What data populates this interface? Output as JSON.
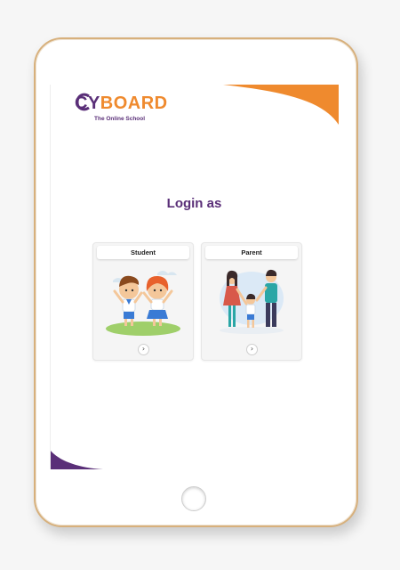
{
  "brand": {
    "name_prefix": "CY",
    "name_suffix": "BOARD",
    "tagline": "The Online School",
    "color_purple": "#5a2f78",
    "color_orange": "#ef8a2e"
  },
  "heading": "Login as",
  "options": [
    {
      "label": "Student",
      "illustration": "students-illustration",
      "action_icon": "chevron-right-icon",
      "arrow_glyph": "›"
    },
    {
      "label": "Parent",
      "illustration": "family-illustration",
      "action_icon": "chevron-right-icon",
      "arrow_glyph": "›"
    }
  ]
}
